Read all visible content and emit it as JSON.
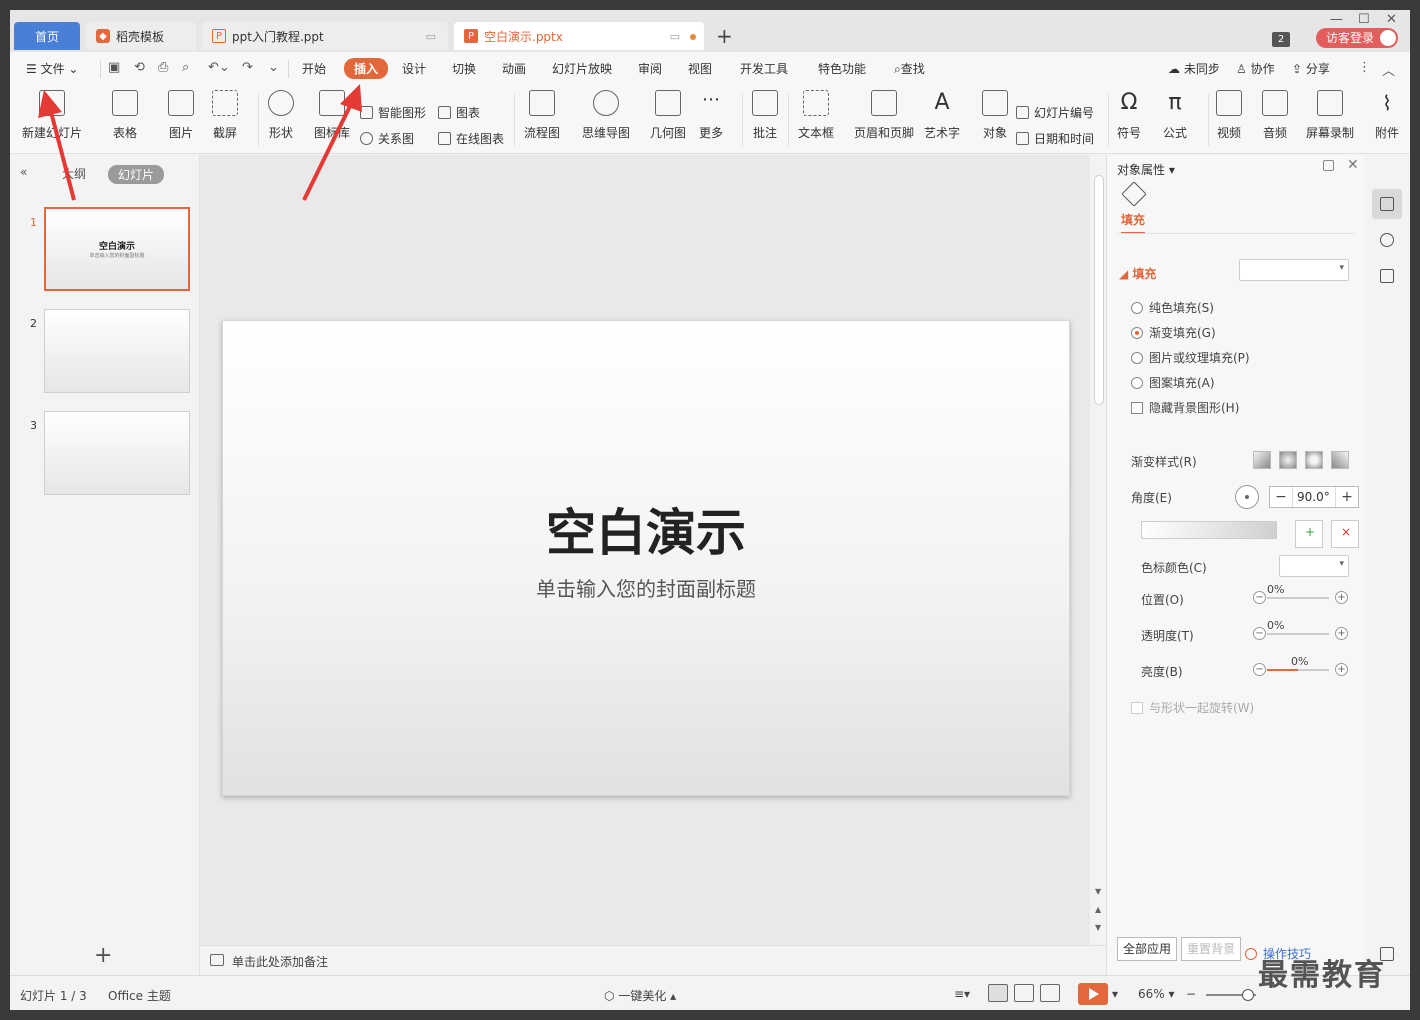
{
  "tabs": {
    "home": "首页",
    "template": "稻壳模板",
    "file1": "ppt入门教程.ppt",
    "file2": "空白演示.pptx",
    "window_count": "2",
    "login": "访客登录"
  },
  "menu": {
    "file": "文件",
    "items": [
      "开始",
      "插入",
      "设计",
      "切换",
      "动画",
      "幻灯片放映",
      "审阅",
      "视图",
      "开发工具",
      "特色功能"
    ],
    "active": "插入",
    "search": "查找",
    "sync": "未同步",
    "collab": "协作",
    "share": "分享"
  },
  "ribbon": {
    "new_slide": "新建幻灯片",
    "table": "表格",
    "picture": "图片",
    "screenshot": "截屏",
    "shape": "形状",
    "icon_lib": "图标库",
    "smart_art": "智能图形",
    "chart": "图表",
    "relation": "关系图",
    "online_chart": "在线图表",
    "flowchart": "流程图",
    "mindmap": "思维导图",
    "geometry": "几何图",
    "more": "更多",
    "comment": "批注",
    "textbox": "文本框",
    "header_footer": "页眉和页脚",
    "wordart": "艺术字",
    "object": "对象",
    "slide_number": "幻灯片编号",
    "datetime": "日期和时间",
    "symbol": "符号",
    "formula": "公式",
    "video": "视频",
    "audio": "音频",
    "screen_record": "屏幕录制",
    "attachment": "附件"
  },
  "left_panel": {
    "outline_tab": "大纲",
    "slides_tab": "幻灯片",
    "slides": [
      {
        "num": "1",
        "title": "空白演示",
        "subtitle": "单击输入您的封面副标题"
      },
      {
        "num": "2"
      },
      {
        "num": "3"
      }
    ]
  },
  "slide": {
    "title": "空白演示",
    "subtitle": "单击输入您的封面副标题"
  },
  "notes": {
    "placeholder": "单击此处添加备注"
  },
  "properties": {
    "title": "对象属性",
    "fill_tab": "填充",
    "section": "填充",
    "options": [
      "纯色填充(S)",
      "渐变填充(G)",
      "图片或纹理填充(P)",
      "图案填充(A)"
    ],
    "selected_option": "渐变填充(G)",
    "hide_bg": "隐藏背景图形(H)",
    "gradient_style": "渐变样式(R)",
    "angle_label": "角度(E)",
    "angle_value": "90.0°",
    "stop_color": "色标颜色(C)",
    "position": "位置(O)",
    "position_value": "0%",
    "transparency": "透明度(T)",
    "transparency_value": "0%",
    "brightness": "亮度(B)",
    "brightness_value": "0%",
    "rotate_with_shape": "与形状一起旋转(W)",
    "apply_all": "全部应用",
    "reset_bg": "重置背景",
    "tips": "操作技巧"
  },
  "status": {
    "slide_counter": "幻灯片 1 / 3",
    "theme": "Office 主题",
    "beautify": "一键美化",
    "zoom": "66%"
  },
  "watermark": "最需教育",
  "colors": {
    "accent": "#e2683b",
    "home_tab": "#4a7fd8",
    "login": "#e35d5d"
  }
}
